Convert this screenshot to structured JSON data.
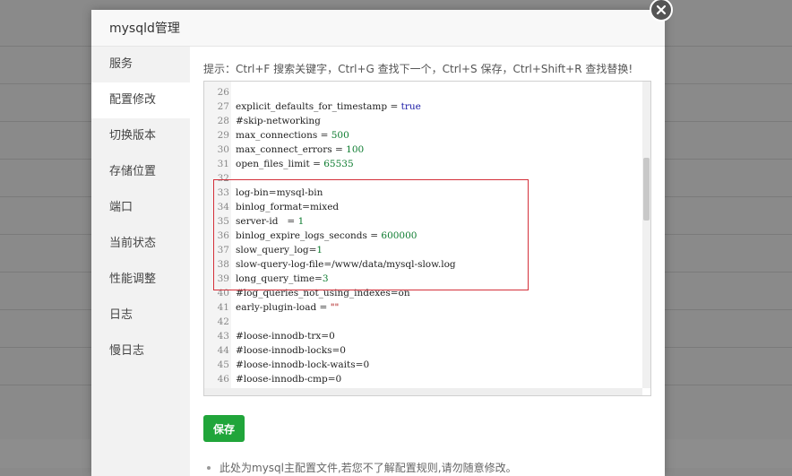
{
  "modal": {
    "title": "mysqld管理",
    "close_icon": "close-icon"
  },
  "sidebar": {
    "items": [
      {
        "label": "服务"
      },
      {
        "label": "配置修改",
        "active": true
      },
      {
        "label": "切换版本"
      },
      {
        "label": "存储位置"
      },
      {
        "label": "端口"
      },
      {
        "label": "当前状态"
      },
      {
        "label": "性能调整"
      },
      {
        "label": "日志"
      },
      {
        "label": "慢日志"
      }
    ]
  },
  "content": {
    "tip": "提示：Ctrl+F 搜索关键字，Ctrl+G 查找下一个，Ctrl+S 保存，Ctrl+Shift+R 查找替换!",
    "save_label": "保存",
    "note": "此处为mysql主配置文件,若您不了解配置规则,请勿随意修改。"
  },
  "editor": {
    "lines": [
      {
        "n": "26",
        "text": ""
      },
      {
        "n": "27",
        "text": "explicit_defaults_for_timestamp = true"
      },
      {
        "n": "28",
        "text": "#skip-networking"
      },
      {
        "n": "29",
        "text": "max_connections = 500"
      },
      {
        "n": "30",
        "text": "max_connect_errors = 100"
      },
      {
        "n": "31",
        "text": "open_files_limit = 65535"
      },
      {
        "n": "32",
        "text": ""
      },
      {
        "n": "33",
        "text": "log-bin=mysql-bin"
      },
      {
        "n": "34",
        "text": "binlog_format=mixed"
      },
      {
        "n": "35",
        "text": "server-id   = 1"
      },
      {
        "n": "36",
        "text": "binlog_expire_logs_seconds = 600000"
      },
      {
        "n": "37",
        "text": "slow_query_log=1"
      },
      {
        "n": "38",
        "text": "slow-query-log-file=/www/data/mysql-slow.log"
      },
      {
        "n": "39",
        "text": "long_query_time=3"
      },
      {
        "n": "40",
        "text": "#log_queries_not_using_indexes=on"
      },
      {
        "n": "41",
        "text": "early-plugin-load = \"\""
      },
      {
        "n": "42",
        "text": ""
      },
      {
        "n": "43",
        "text": "#loose-innodb-trx=0"
      },
      {
        "n": "44",
        "text": "#loose-innodb-locks=0"
      },
      {
        "n": "45",
        "text": "#loose-innodb-lock-waits=0"
      },
      {
        "n": "46",
        "text": "#loose-innodb-cmp=0"
      }
    ]
  },
  "colors": {
    "accent": "#20a53a",
    "highlight_border": "#d4303a"
  }
}
